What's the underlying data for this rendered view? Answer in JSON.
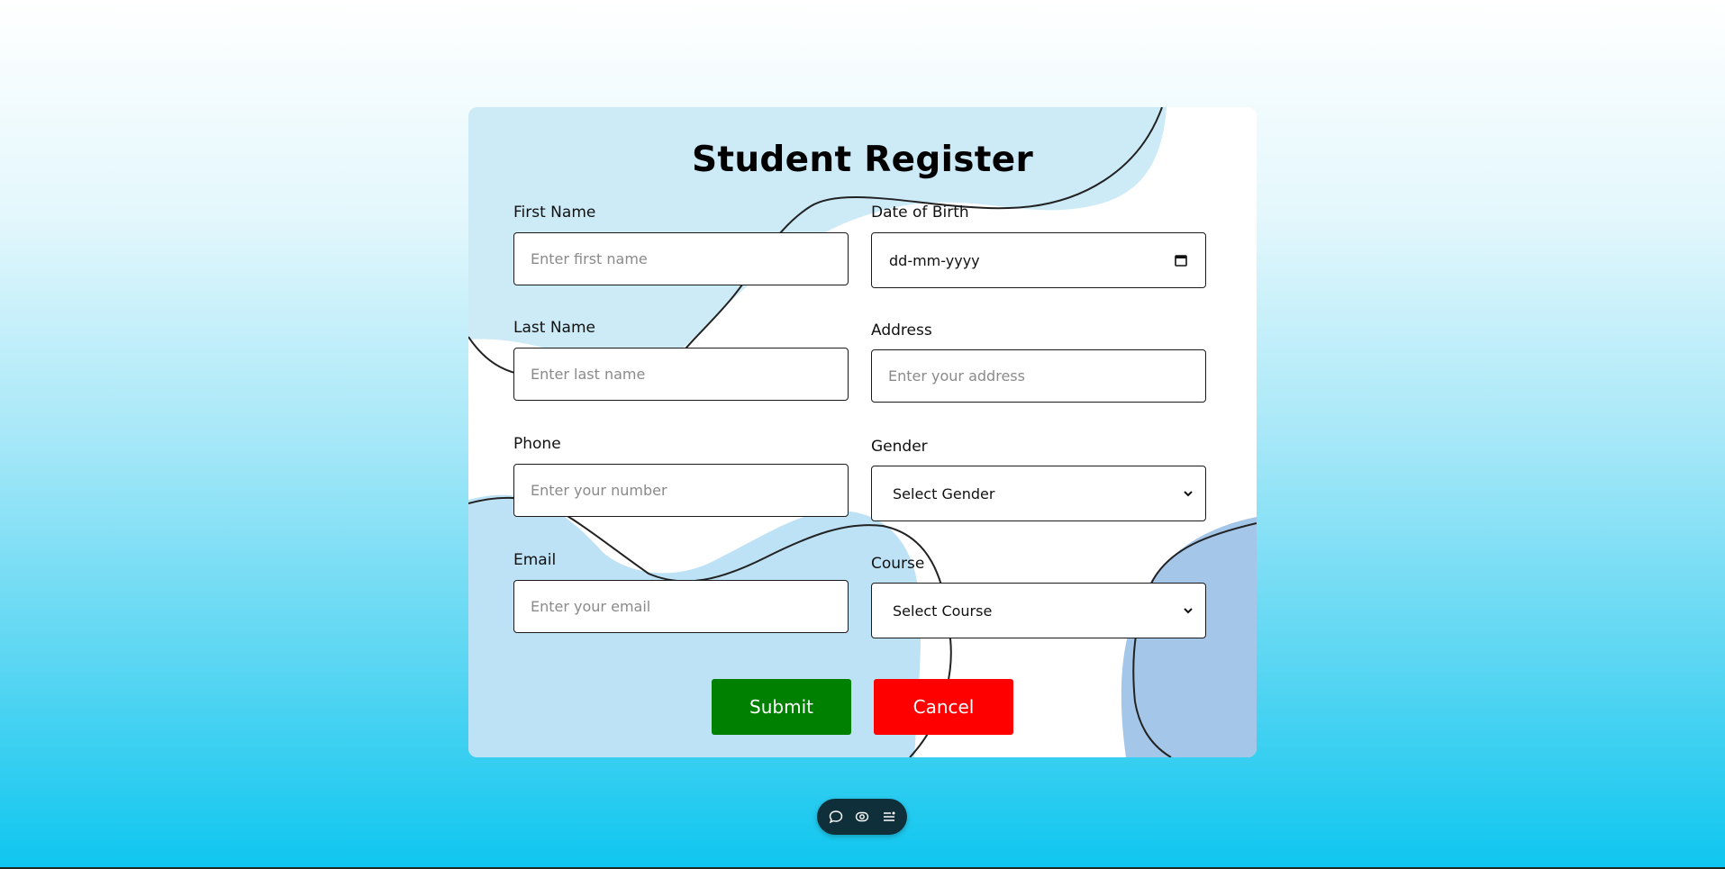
{
  "form": {
    "title": "Student Register",
    "first_name": {
      "label": "First Name",
      "placeholder": "Enter first name"
    },
    "last_name": {
      "label": "Last Name",
      "placeholder": "Enter last name"
    },
    "phone": {
      "label": "Phone",
      "placeholder": "Enter your number"
    },
    "email": {
      "label": "Email",
      "placeholder": "Enter your email"
    },
    "dob": {
      "label": "Date of Birth",
      "value": "dd-mm-yyyy",
      "icon": "calendar-icon"
    },
    "address": {
      "label": "Address",
      "placeholder": "Enter your address"
    },
    "gender": {
      "label": "Gender",
      "selected": "Select Gender",
      "icon": "chevron-down-icon"
    },
    "course": {
      "label": "Course",
      "selected": "Select Course",
      "icon": "chevron-down-icon"
    },
    "submit_label": "Submit",
    "cancel_label": "Cancel"
  },
  "toolbar": {
    "icons": [
      "comment-icon",
      "eye-icon",
      "list-icon"
    ]
  },
  "colors": {
    "submit": "#008000",
    "cancel": "#ff0000",
    "blob_light": "#cdeaf7",
    "blob_mid": "#bde2f6",
    "blob_dark": "#a3c6e9",
    "toolbar": "#0f2f3a"
  }
}
